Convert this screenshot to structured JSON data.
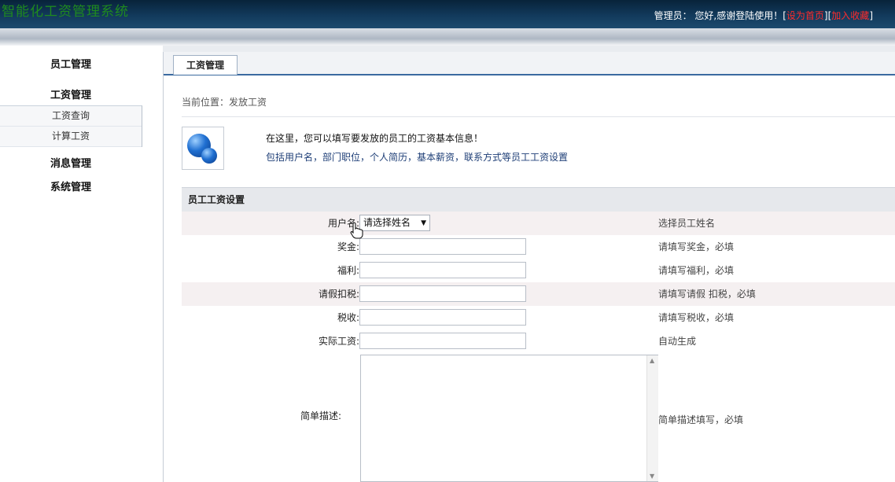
{
  "header": {
    "app_title": "智能化工资管理系统",
    "greeting": "管理员：  您好,感谢登陆使用！",
    "set_home_label": "设为首页",
    "add_favorite_label": "加入收藏",
    "bracket_open": "[",
    "bracket_close": "]"
  },
  "sidebar": {
    "groups": [
      {
        "label": "员工管理"
      },
      {
        "label": "工资管理"
      },
      {
        "label": "消息管理"
      },
      {
        "label": "系统管理"
      }
    ],
    "subitems": [
      {
        "label": "工资查询"
      },
      {
        "label": "计算工资"
      }
    ]
  },
  "main": {
    "tab_label": "工资管理",
    "breadcrumb": "当前位置：发放工资",
    "info_line1": "在这里，您可以填写要发放的员工的工资基本信息！",
    "info_line2": "包括用户名，部门职位，个人简历，基本薪资，联系方式等员工工资设置",
    "form_title": "员工工资设置"
  },
  "form": {
    "username": {
      "label": "用户名:",
      "selected": "请选择姓名",
      "hint": "选择员工姓名"
    },
    "bonus": {
      "label": "奖金:",
      "value": "",
      "hint": "请填写奖金，必填"
    },
    "welfare": {
      "label": "福利:",
      "value": "",
      "hint": "请填写福利，必填"
    },
    "leave_deduction": {
      "label": "请假扣税:",
      "value": "",
      "hint": "请填写请假 扣税，必填"
    },
    "tax": {
      "label": "税收:",
      "value": "",
      "hint": "请填写税收，必填"
    },
    "actual_salary": {
      "label": "实际工资:",
      "value": "",
      "hint": "自动生成"
    },
    "description": {
      "label": "简单描述:",
      "value": "",
      "hint": "简单描述填写，必填"
    }
  },
  "icons": {
    "cursor": "hand-pointer-icon",
    "info": "globe-icon",
    "dropdown": "chevron-down-icon"
  }
}
